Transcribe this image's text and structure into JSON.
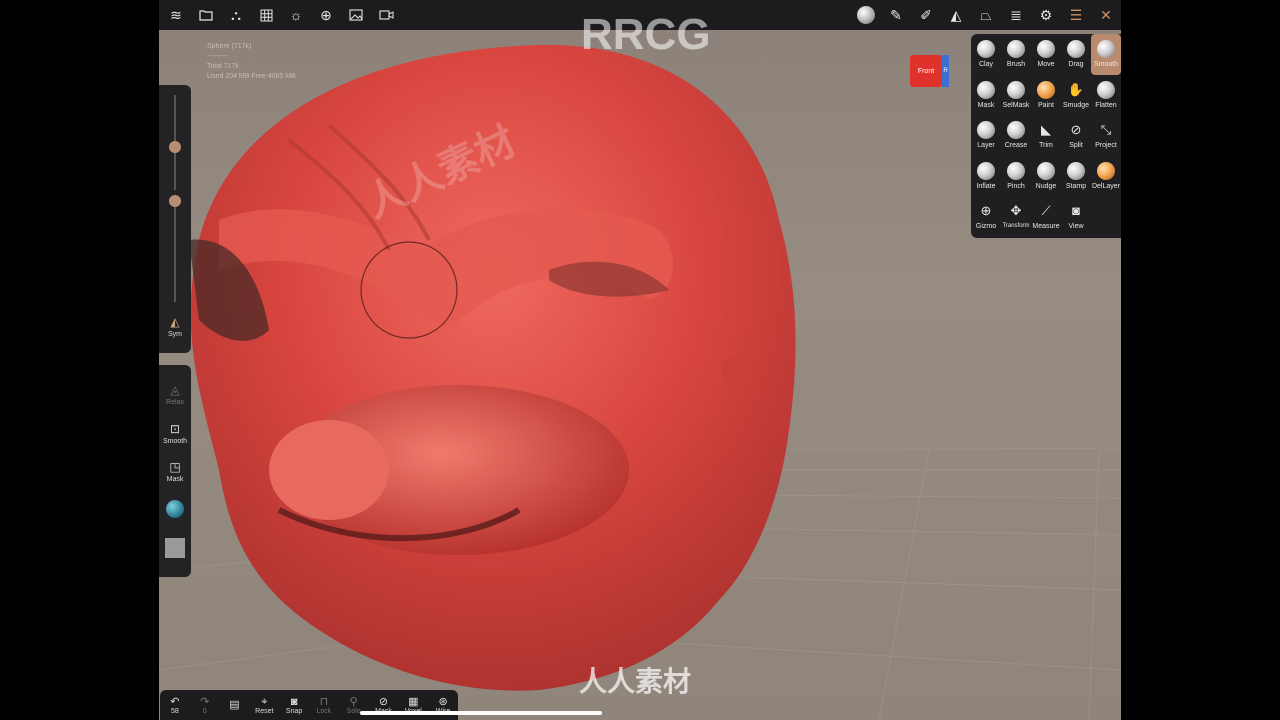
{
  "stats": {
    "mesh": "Sphere (717k)",
    "sep": "---------",
    "total": "Total 717k",
    "memory": "Used 204 MB   Free 4065 MB"
  },
  "topbar": {
    "left_icons": [
      "app-logo-icon",
      "folder-icon",
      "scene-icon",
      "grid-icon",
      "sun-icon",
      "globe-icon",
      "image-icon",
      "video-icon"
    ],
    "right_icons": [
      "brush-preview-icon",
      "brush-icon",
      "eyedropper-icon",
      "symmetry-icon",
      "topology-icon",
      "layers-icon",
      "settings-icon",
      "sliders-icon",
      "tools-icon"
    ]
  },
  "cube": {
    "front": "Front",
    "side": "R"
  },
  "left_panel": {
    "sym_label": "Sym",
    "relax_label": "Relax",
    "smooth_label": "Smooth",
    "mask_label": "Mask"
  },
  "tools": [
    {
      "label": "Clay"
    },
    {
      "label": "Brush"
    },
    {
      "label": "Move"
    },
    {
      "label": "Drag"
    },
    {
      "label": "Smooth",
      "active": true
    },
    {
      "label": "Mask"
    },
    {
      "label": "SelMask"
    },
    {
      "label": "Paint"
    },
    {
      "label": "Smudge"
    },
    {
      "label": "Flatten"
    },
    {
      "label": "Layer"
    },
    {
      "label": "Crease"
    },
    {
      "label": "Trim"
    },
    {
      "label": "Split"
    },
    {
      "label": "Project"
    },
    {
      "label": "Inflate"
    },
    {
      "label": "Pinch"
    },
    {
      "label": "Nudge"
    },
    {
      "label": "Stamp"
    },
    {
      "label": "DelLayer"
    },
    {
      "label": "Gizmo"
    },
    {
      "label": "Transform"
    },
    {
      "label": "Measure"
    },
    {
      "label": "View"
    }
  ],
  "bottombar": {
    "undo_count": "58",
    "redo_count": "0",
    "reset": "Reset",
    "snap": "Snap",
    "lock": "Lock",
    "solo": "Solo",
    "mask": "Mask",
    "voxel": "Voxel",
    "wire": "Wire"
  },
  "watermarks": {
    "rrcg": "RRCG",
    "cn": "人人素材"
  },
  "colors": {
    "accent": "#b98a6d",
    "mesh": "#d8453f",
    "panel": "#1f1f21"
  }
}
